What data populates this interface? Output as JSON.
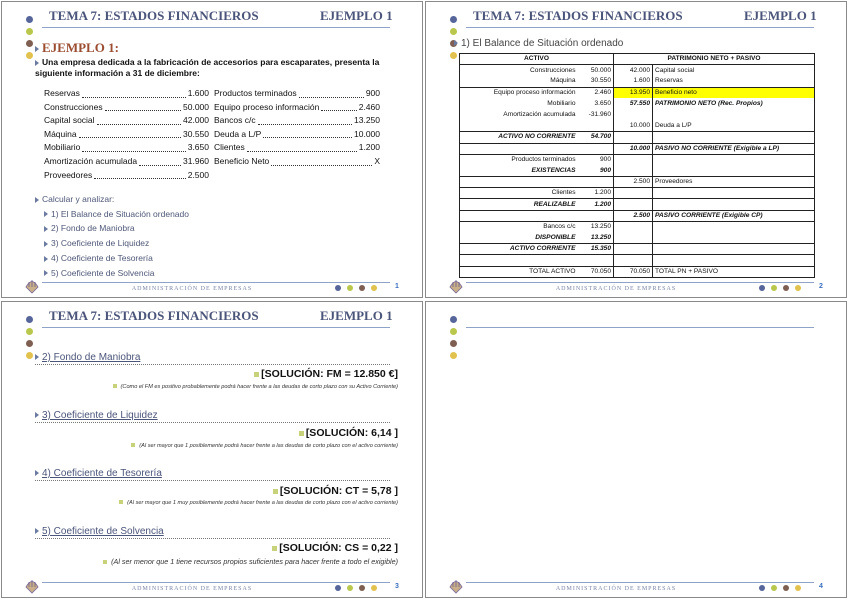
{
  "header": {
    "title": "TEMA 7:  ESTADOS FINANCIEROS",
    "example": "EJEMPLO 1"
  },
  "footer": {
    "text": "ADMINISTRACIÓN DE EMPRESAS"
  },
  "colors": {
    "dots": [
      "#56659a",
      "#b9c84c",
      "#7f5f52",
      "#e2c24e"
    ],
    "title": "#4b557a",
    "accent": "#9b4d32",
    "highlight": "#ffff00"
  },
  "slide1": {
    "page": "1",
    "heading": "EJEMPLO 1:",
    "intro": "Una empresa dedicada a la fabricación de accesorios para escaparates, presenta la siguiente información a 31 de diciembre:",
    "left": [
      {
        "label": "Reservas",
        "value": "1.600"
      },
      {
        "label": "Construcciones",
        "value": "50.000"
      },
      {
        "label": "Capital social",
        "value": "42.000"
      },
      {
        "label": "Máquina",
        "value": "30.550"
      },
      {
        "label": "Mobiliario",
        "value": "3.650"
      },
      {
        "label": "Amortización acumulada",
        "value": "31.960"
      },
      {
        "label": "Proveedores",
        "value": "2.500"
      }
    ],
    "right": [
      {
        "label": "Productos terminados",
        "value": "900"
      },
      {
        "label": "Equipo proceso información",
        "value": "2.460"
      },
      {
        "label": "Bancos c/c",
        "value": "13.250"
      },
      {
        "label": "Deuda a L/P",
        "value": "10.000"
      },
      {
        "label": "Clientes",
        "value": "1.200"
      },
      {
        "label": "Beneficio Neto",
        "value": "X"
      }
    ],
    "calc_label": "Calcular y analizar:",
    "calc_items": [
      "1) El Balance de Situación ordenado",
      "2) Fondo de Maniobra",
      "3) Coeficiente de Liquidez",
      "4) Coeficiente de Tesorería",
      "5) Coeficiente de Solvencia"
    ]
  },
  "slide2": {
    "page": "2",
    "subtitle": "1) El Balance de Situación ordenado",
    "headers": {
      "activo": "ACTIVO",
      "pasivo": "PATRIMONIO NETO + PASIVO"
    },
    "rows": [
      {
        "al": "Construcciones",
        "av": "50.000",
        "pv": "42.000",
        "pl": "Capital social"
      },
      {
        "al": "Máquina",
        "av": "30.550",
        "pv": "1.600",
        "pl": "Reservas"
      },
      {
        "al": "Equipo proceso información",
        "av": "2.460",
        "pv": "13.950",
        "pl": "Beneficio neto",
        "hl": true,
        "bt": true
      },
      {
        "al": "Mobiliario",
        "av": "3.650",
        "pv": "57.550",
        "pl": "PATRIMONIO NETO (Rec. Propios)",
        "pb": true
      },
      {
        "al": "Amortización acumulada",
        "av": "-31.960",
        "pv": "",
        "pl": ""
      },
      {
        "al": "",
        "av": "",
        "pv": "10.000",
        "pl": "Deuda a L/P"
      },
      {
        "al": "ACTIVO NO CORRIENTE",
        "av": "54.700",
        "pv": "",
        "pl": "",
        "ab": true,
        "bt": true
      },
      {
        "al": "",
        "av": "",
        "pv": "10.000",
        "pl": "PASIVO NO CORRIENTE (Exigible a LP)",
        "pb": true,
        "bt": true
      },
      {
        "al": "Productos terminados",
        "av": "900",
        "pv": "",
        "pl": "",
        "bt": true
      },
      {
        "al": "EXISTENCIAS",
        "av": "900",
        "pv": "",
        "pl": "",
        "ab": true
      },
      {
        "al": "",
        "av": "",
        "pv": "2.500",
        "pl": "Proveedores",
        "bt": true
      },
      {
        "al": "Clientes",
        "av": "1.200",
        "pv": "",
        "pl": "",
        "bt": true
      },
      {
        "al": "REALIZABLE",
        "av": "1.200",
        "pv": "",
        "pl": "",
        "ab": true,
        "bt": true
      },
      {
        "al": "",
        "av": "",
        "pv": "2.500",
        "pl": "PASIVO CORRIENTE (Exigible CP)",
        "pb": true,
        "bt": true
      },
      {
        "al": "Bancos c/c",
        "av": "13.250",
        "pv": "",
        "pl": "",
        "bt": true
      },
      {
        "al": "DISPONIBLE",
        "av": "13.250",
        "pv": "",
        "pl": "",
        "ab": true
      },
      {
        "al": "ACTIVO CORRIENTE",
        "av": "15.350",
        "pv": "",
        "pl": "",
        "ab": true,
        "bt": true
      },
      {
        "al": "",
        "av": "",
        "pv": "",
        "pl": "",
        "bt": true
      },
      {
        "al": "TOTAL ACTIVO",
        "av": "70.050",
        "pv": "70.050",
        "pl": "TOTAL PN + PASIVO",
        "bt": true
      }
    ]
  },
  "slide3": {
    "page": "3",
    "sections": [
      {
        "title": "2) Fondo de Maniobra",
        "solution": "[SOLUCIÓN:   FM = 12.850 €]",
        "note": "(Como el FM es positivo probablemente podrá hacer frente a las deudas de corto plazo con su Activo Corriente)"
      },
      {
        "title": "3) Coeficiente de Liquidez",
        "solution": "[SOLUCIÓN:    6,14 ]",
        "note": "(Al ser mayor que 1 posiblemente podrá hacer frente a las deudas de corto plazo con el activo corriente)"
      },
      {
        "title": "4) Coeficiente de Tesorería",
        "solution": "[SOLUCIÓN:   CT = 5,78 ]",
        "note": "(Al ser mayor que 1 muy posiblemente podrá hacer frente a las deudas de corto plazo con el activo corriente)"
      },
      {
        "title": "5) Coeficiente de Solvencia",
        "solution": "[SOLUCIÓN:   CS = 0,22 ]",
        "note": "(Al ser menor que 1 tiene recursos propios suficientes para hacer frente a todo el exigible)"
      }
    ]
  },
  "slide4": {
    "page": "4"
  }
}
